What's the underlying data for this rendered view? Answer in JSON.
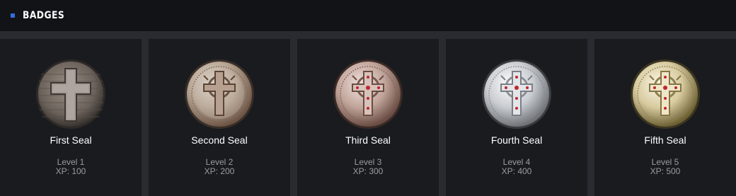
{
  "header": {
    "title": "BADGES",
    "accent": "#2f6fe0"
  },
  "badges": [
    {
      "name": "First Seal",
      "level": "Level 1",
      "xp": "XP: 100",
      "icon": "wooden-cross-seal-icon"
    },
    {
      "name": "Second Seal",
      "level": "Level 2",
      "xp": "XP: 200",
      "icon": "rusted-iron-celtic-cross-seal-icon"
    },
    {
      "name": "Third Seal",
      "level": "Level 3",
      "xp": "XP: 300",
      "icon": "bronze-celtic-cross-seal-icon"
    },
    {
      "name": "Fourth Seal",
      "level": "Level 4",
      "xp": "XP: 400",
      "icon": "silver-celtic-cross-seal-icon"
    },
    {
      "name": "Fifth Seal",
      "level": "Level 5",
      "xp": "XP: 500",
      "icon": "gold-celtic-cross-seal-icon"
    }
  ]
}
